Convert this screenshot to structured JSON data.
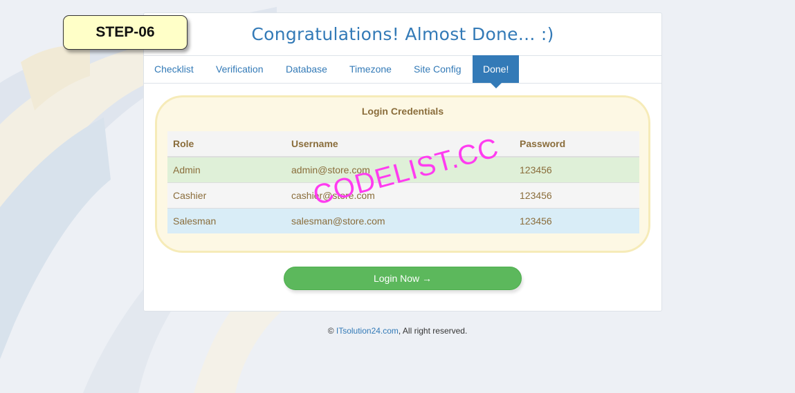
{
  "step_badge": "STEP-06",
  "title": "Congratulations! Almost Done... :)",
  "tabs": [
    {
      "label": "Checklist",
      "active": false
    },
    {
      "label": "Verification",
      "active": false
    },
    {
      "label": "Database",
      "active": false
    },
    {
      "label": "Timezone",
      "active": false
    },
    {
      "label": "Site Config",
      "active": false
    },
    {
      "label": "Done!",
      "active": true
    }
  ],
  "credentials": {
    "title": "Login Credentials",
    "columns": [
      "Role",
      "Username",
      "Password"
    ],
    "rows": [
      {
        "role": "Admin",
        "username": "admin@store.com",
        "password": "123456"
      },
      {
        "role": "Cashier",
        "username": "cashier@store.com",
        "password": "123456"
      },
      {
        "role": "Salesman",
        "username": "salesman@store.com",
        "password": "123456"
      }
    ]
  },
  "login_button": "Login Now →",
  "footer": {
    "prefix": "© ",
    "link": "ITsolution24.com",
    "suffix": ", All right reserved."
  },
  "watermark": "CODELIST.CC",
  "colors": {
    "accent": "#337ab7",
    "success": "#5cb85c",
    "warning_text": "#8a6d3b",
    "badge_bg": "#ffffc8",
    "watermark": "#ff3cf0"
  }
}
